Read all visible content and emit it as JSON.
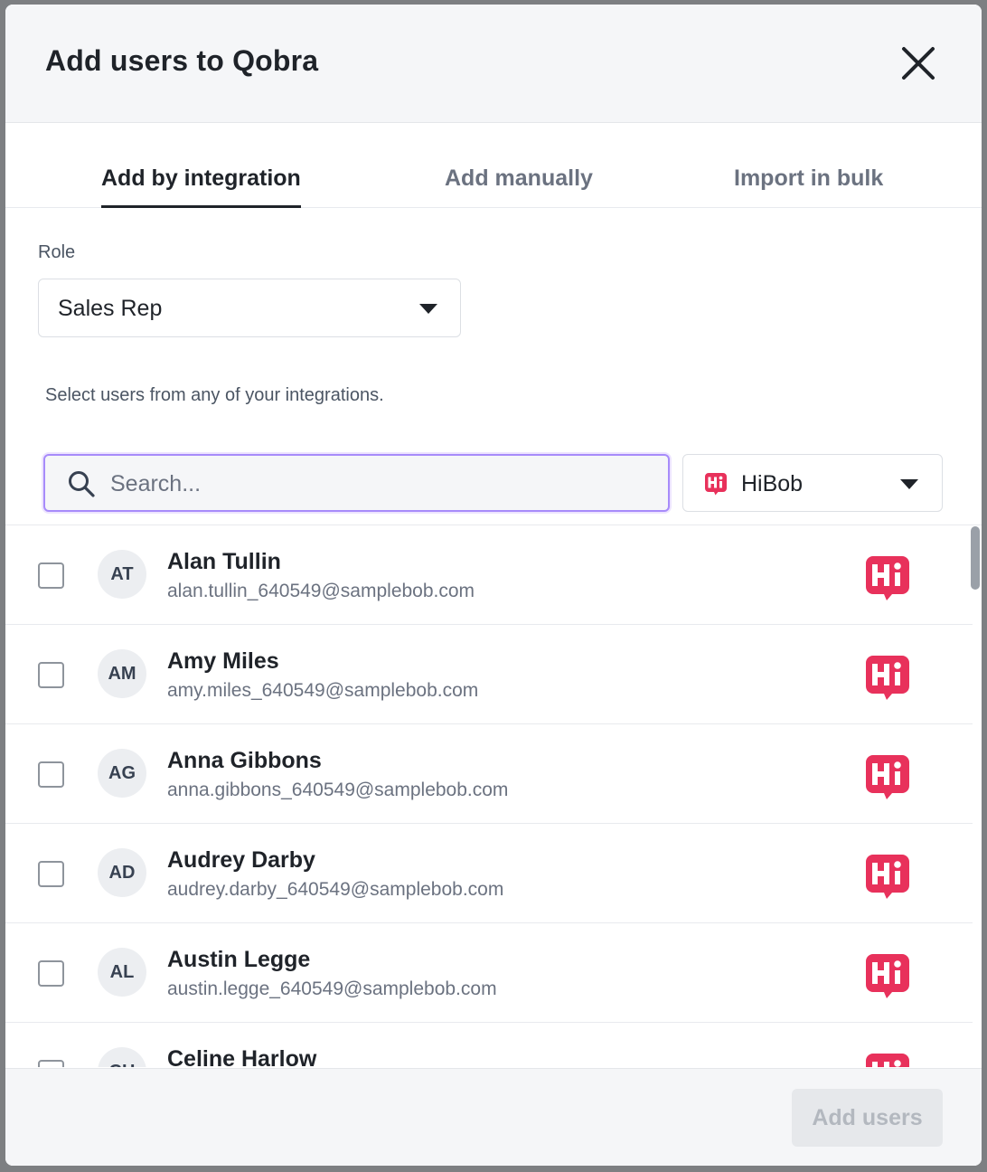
{
  "modal": {
    "title": "Add users to Qobra"
  },
  "tabs": [
    {
      "label": "Add by integration",
      "active": true
    },
    {
      "label": "Add manually",
      "active": false
    },
    {
      "label": "Import in bulk",
      "active": false
    }
  ],
  "role": {
    "label": "Role",
    "selected": "Sales Rep"
  },
  "hint": "Select users from any of your integrations.",
  "search": {
    "placeholder": "Search...",
    "value": ""
  },
  "integration": {
    "selected": "HiBob",
    "icon": "hibob-icon",
    "brand_color": "#e8315b"
  },
  "users": [
    {
      "initials": "AT",
      "name": "Alan Tullin",
      "email": "alan.tullin_640549@samplebob.com"
    },
    {
      "initials": "AM",
      "name": "Amy Miles",
      "email": "amy.miles_640549@samplebob.com"
    },
    {
      "initials": "AG",
      "name": "Anna Gibbons",
      "email": "anna.gibbons_640549@samplebob.com"
    },
    {
      "initials": "AD",
      "name": "Audrey Darby",
      "email": "audrey.darby_640549@samplebob.com"
    },
    {
      "initials": "AL",
      "name": "Austin Legge",
      "email": "austin.legge_640549@samplebob.com"
    },
    {
      "initials": "CH",
      "name": "Celine Harlow",
      "email": ""
    }
  ],
  "footer": {
    "add_label": "Add users",
    "disabled": true
  }
}
